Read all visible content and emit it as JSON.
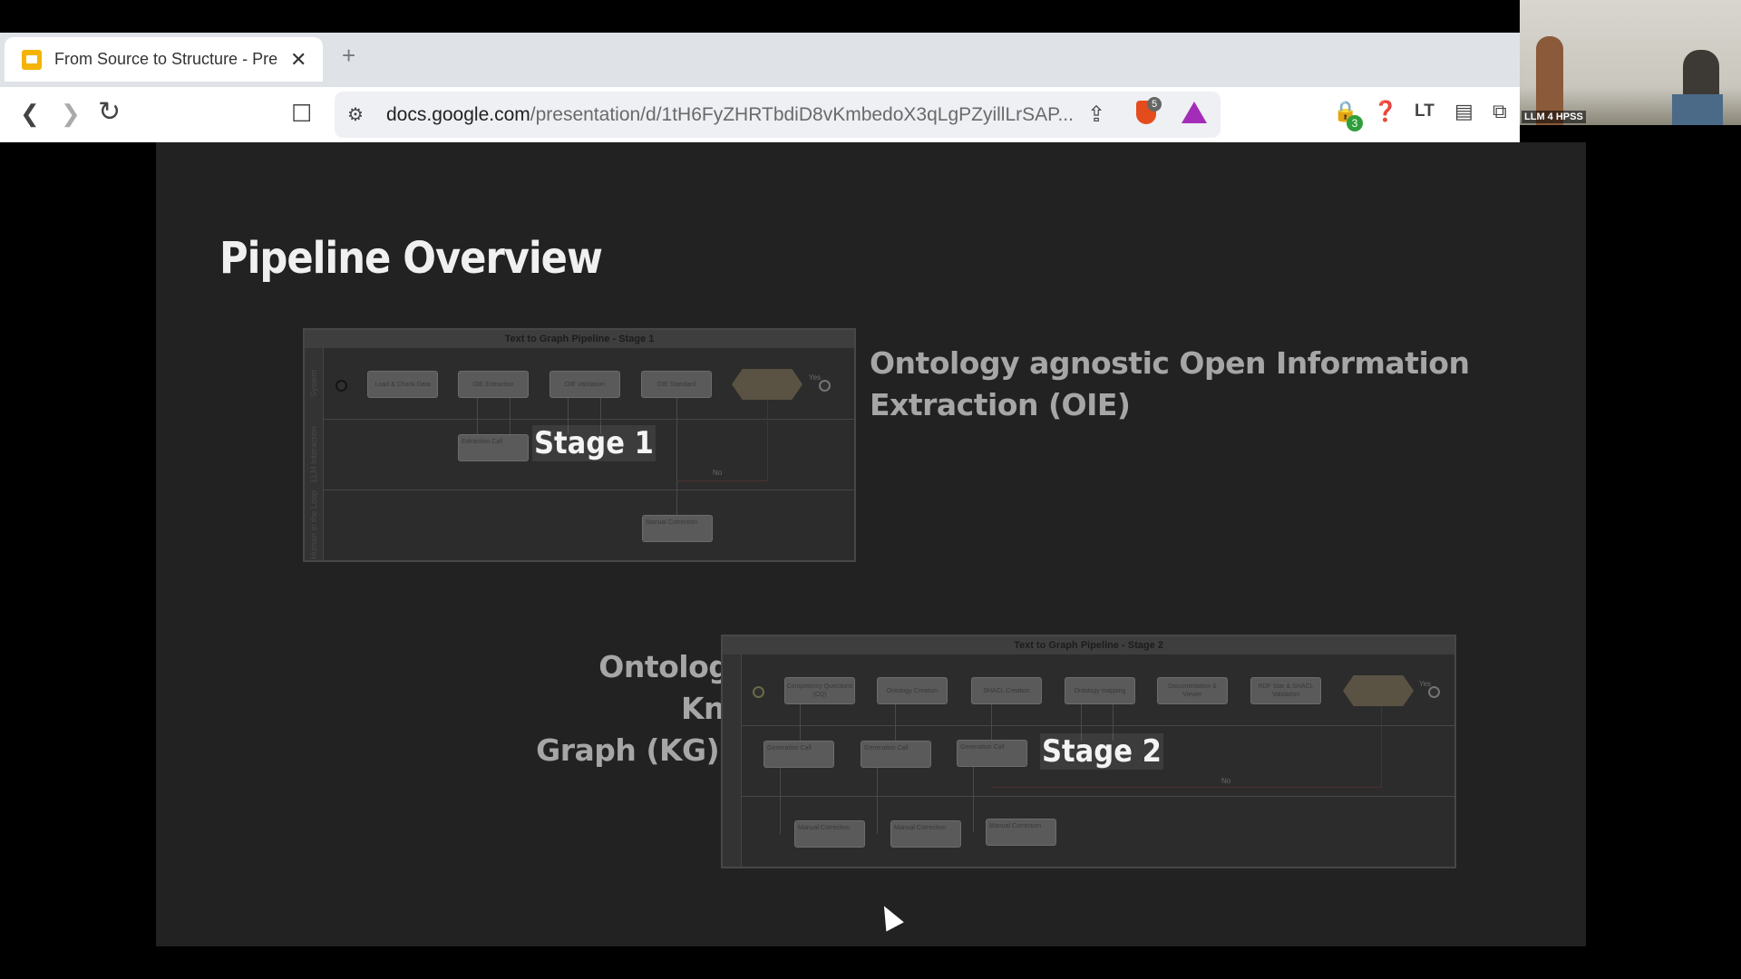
{
  "browser": {
    "tab_title": "From Source to Structure - Pres",
    "tab_close": "✕",
    "new_tab": "+",
    "back": "❮",
    "forward": "❯",
    "reload": "↻",
    "bookmark": "☐",
    "url_host": "docs.google.com",
    "url_path": "/presentation/d/1tH6FyZHRTbdiD8vKmbedoX3qLgPZyillLrSAP...",
    "brave_shield_count": "5",
    "extension_badge": "3",
    "ext_lt_label": "LT"
  },
  "camera": {
    "label": "LLM 4 HPSS"
  },
  "slide": {
    "title": "Pipeline Overview",
    "stage1": {
      "overlay": "Stage 1",
      "description_line1": "Ontology agnostic Open Information",
      "description_line2": "Extraction (OIE)",
      "diagram": {
        "title": "Text to Graph Pipeline - Stage 1",
        "lanes": [
          "System",
          "LLM Interaction",
          "Human in the Loop"
        ],
        "nodes": [
          "Load & Chunk Data",
          "OIE Extraction",
          "OIE Validation",
          "OIE Standard"
        ],
        "task_llm": "Extraction Call",
        "task_human": "Manual Correction",
        "decision_yes": "Yes",
        "decision_no": "No"
      }
    },
    "stage2": {
      "overlay": "Stage 2",
      "description_line1": "Ontology driven Knowledge",
      "description_line2": "Graph (KG) building",
      "diagram": {
        "title": "Text to Graph Pipeline - Stage 2",
        "nodes": [
          "Competency Questions (CQ)",
          "Ontology Creation",
          "SHACL Creation",
          "Ontology mapping",
          "Documentation & Viewer",
          "RDF Star & SHACL Validation"
        ],
        "tasks_llm": [
          "Generation Call",
          "Generation Call",
          "Generation Call"
        ],
        "tasks_human": [
          "Manual Correction",
          "Manual Correction",
          "Manual Correction"
        ],
        "decision_yes": "Yes",
        "decision_no": "No"
      }
    }
  }
}
